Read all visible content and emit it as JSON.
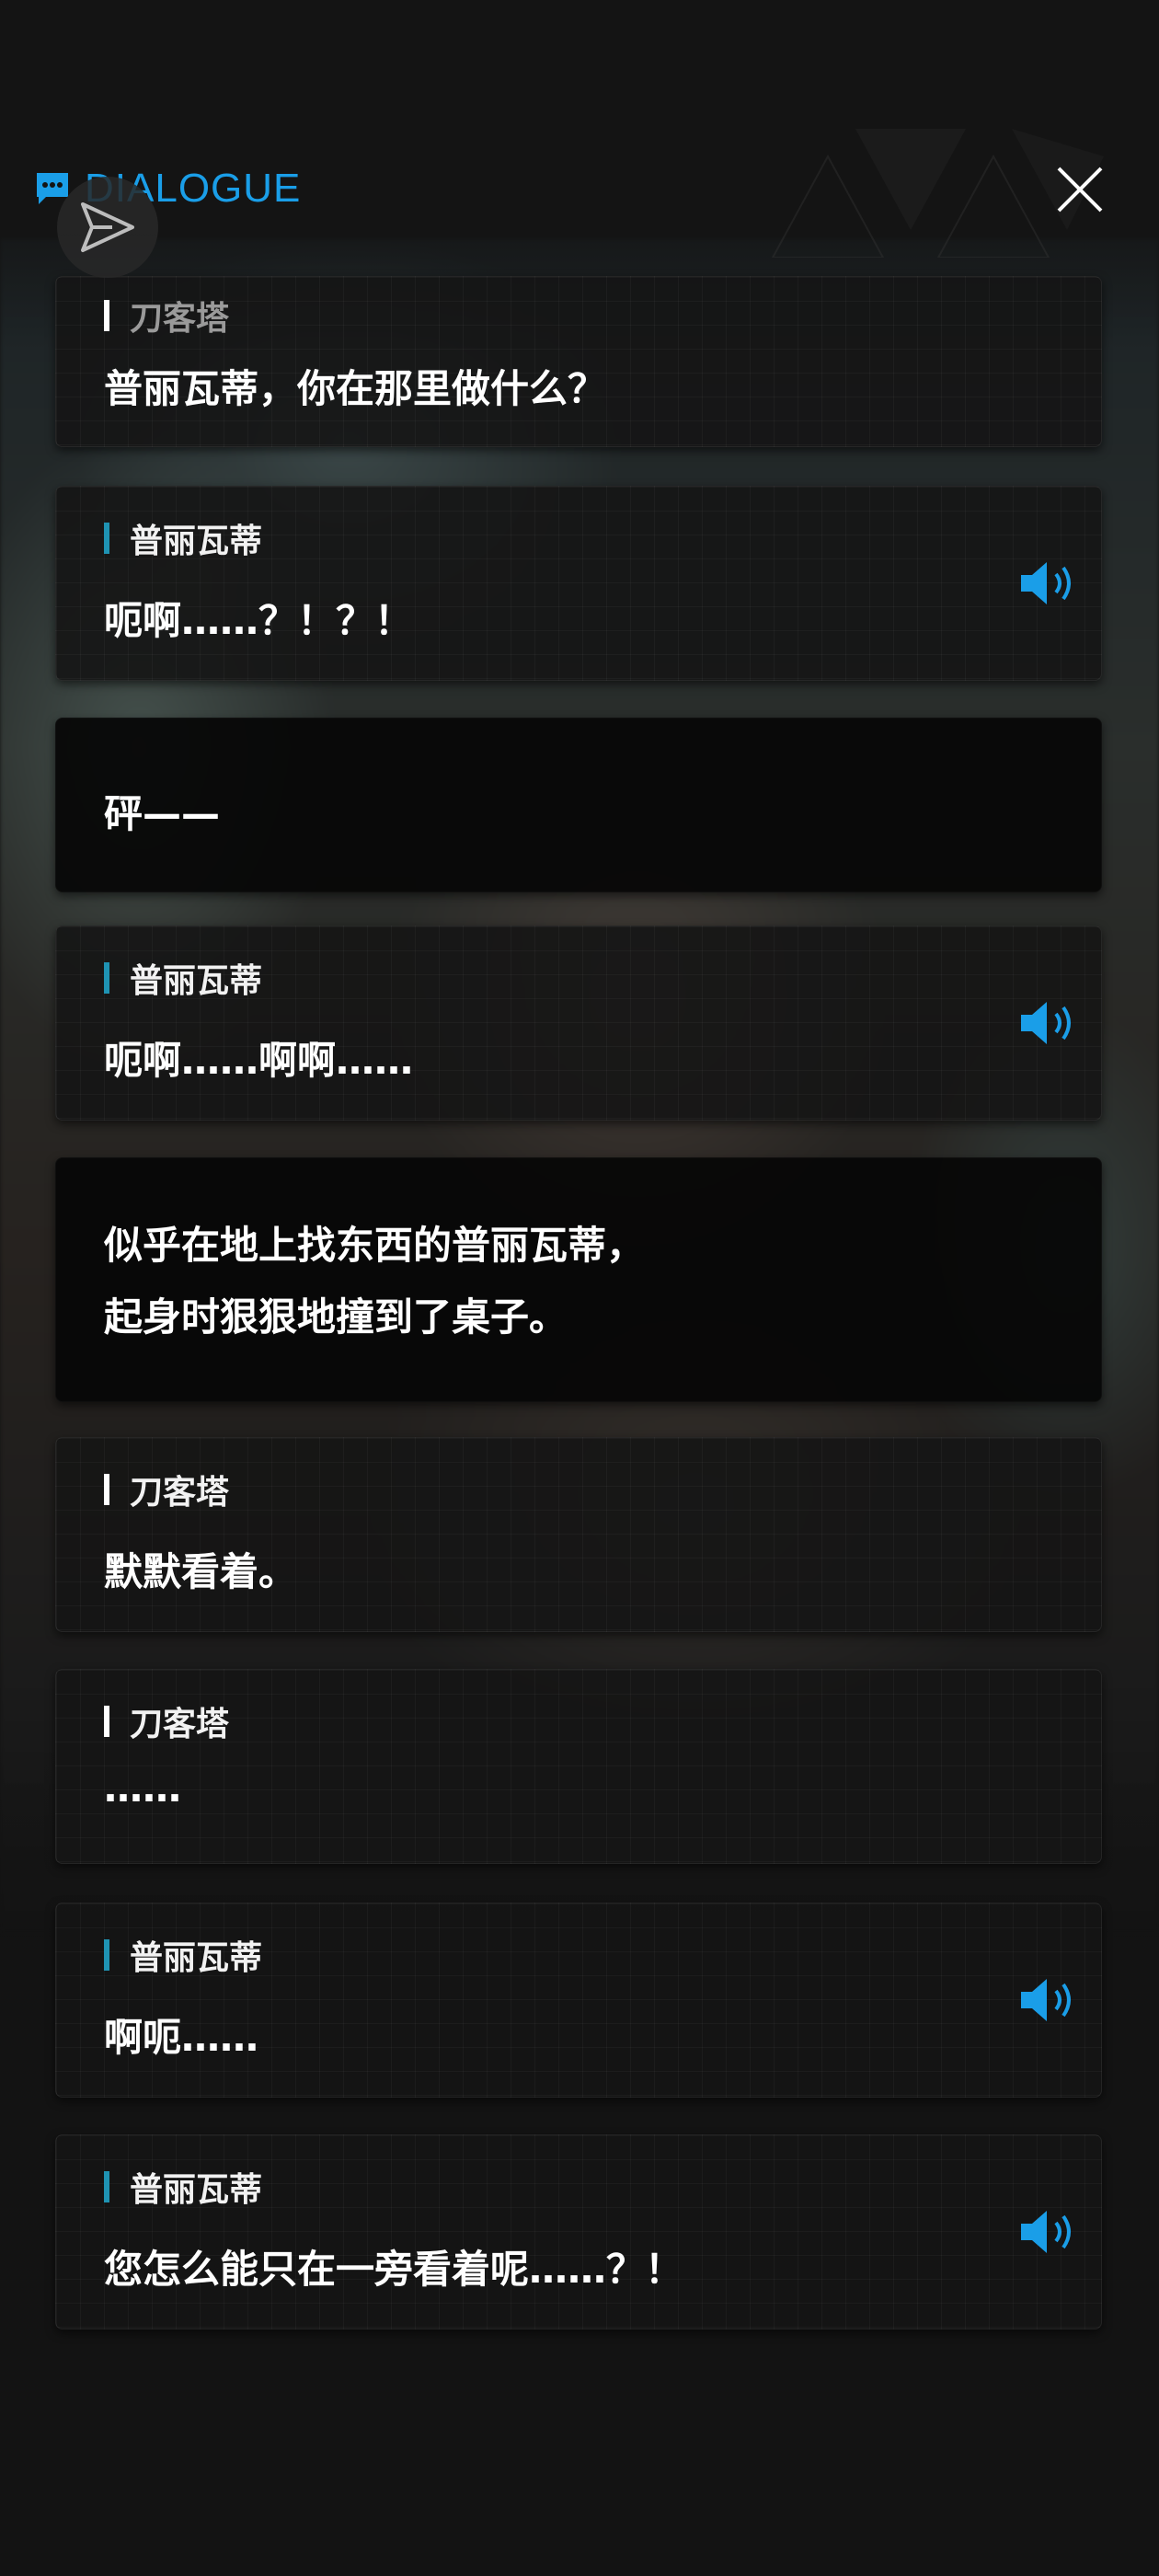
{
  "header": {
    "title": "DIALOGUE",
    "icon": "chat-bubble-icon",
    "accent_color": "#1a9ee8"
  },
  "controls": {
    "close_icon": "close-icon",
    "share_icon": "paper-plane-icon"
  },
  "dialogue": [
    {
      "type": "speech",
      "speaker": "刀客塔",
      "text": "普丽瓦蒂，你在那里做什么？",
      "voice": false
    },
    {
      "type": "speech",
      "speaker": "普丽瓦蒂",
      "text": "呃啊……？！？！",
      "voice": true
    },
    {
      "type": "narration",
      "text": "砰——"
    },
    {
      "type": "speech",
      "speaker": "普丽瓦蒂",
      "text": "呃啊……啊啊……",
      "voice": true
    },
    {
      "type": "narration",
      "lines": [
        "似乎在地上找东西的普丽瓦蒂，",
        "起身时狠狠地撞到了桌子。"
      ]
    },
    {
      "type": "speech",
      "speaker": "刀客塔",
      "text": "默默看着。",
      "voice": false
    },
    {
      "type": "speech",
      "speaker": "刀客塔",
      "text": "……",
      "voice": false
    },
    {
      "type": "speech",
      "speaker": "普丽瓦蒂",
      "text": "啊呃……",
      "voice": true
    },
    {
      "type": "speech",
      "speaker": "普丽瓦蒂",
      "text": "您怎么能只在一旁看着呢……？！",
      "voice": true
    }
  ],
  "colors": {
    "voice_icon": "#1a9ee8",
    "speaker_bar_player": "#ffffff",
    "speaker_bar_character": "#1f93b3",
    "background": "#131313"
  }
}
